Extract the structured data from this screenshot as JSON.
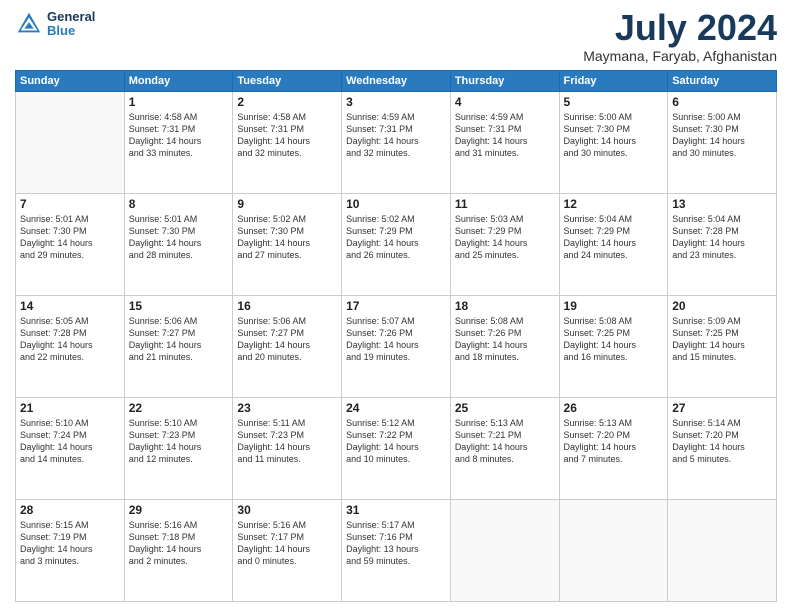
{
  "header": {
    "logo_line1": "General",
    "logo_line2": "Blue",
    "month": "July 2024",
    "location": "Maymana, Faryab, Afghanistan"
  },
  "weekdays": [
    "Sunday",
    "Monday",
    "Tuesday",
    "Wednesday",
    "Thursday",
    "Friday",
    "Saturday"
  ],
  "weeks": [
    [
      {
        "day": "",
        "info": ""
      },
      {
        "day": "1",
        "info": "Sunrise: 4:58 AM\nSunset: 7:31 PM\nDaylight: 14 hours\nand 33 minutes."
      },
      {
        "day": "2",
        "info": "Sunrise: 4:58 AM\nSunset: 7:31 PM\nDaylight: 14 hours\nand 32 minutes."
      },
      {
        "day": "3",
        "info": "Sunrise: 4:59 AM\nSunset: 7:31 PM\nDaylight: 14 hours\nand 32 minutes."
      },
      {
        "day": "4",
        "info": "Sunrise: 4:59 AM\nSunset: 7:31 PM\nDaylight: 14 hours\nand 31 minutes."
      },
      {
        "day": "5",
        "info": "Sunrise: 5:00 AM\nSunset: 7:30 PM\nDaylight: 14 hours\nand 30 minutes."
      },
      {
        "day": "6",
        "info": "Sunrise: 5:00 AM\nSunset: 7:30 PM\nDaylight: 14 hours\nand 30 minutes."
      }
    ],
    [
      {
        "day": "7",
        "info": "Sunrise: 5:01 AM\nSunset: 7:30 PM\nDaylight: 14 hours\nand 29 minutes."
      },
      {
        "day": "8",
        "info": "Sunrise: 5:01 AM\nSunset: 7:30 PM\nDaylight: 14 hours\nand 28 minutes."
      },
      {
        "day": "9",
        "info": "Sunrise: 5:02 AM\nSunset: 7:30 PM\nDaylight: 14 hours\nand 27 minutes."
      },
      {
        "day": "10",
        "info": "Sunrise: 5:02 AM\nSunset: 7:29 PM\nDaylight: 14 hours\nand 26 minutes."
      },
      {
        "day": "11",
        "info": "Sunrise: 5:03 AM\nSunset: 7:29 PM\nDaylight: 14 hours\nand 25 minutes."
      },
      {
        "day": "12",
        "info": "Sunrise: 5:04 AM\nSunset: 7:29 PM\nDaylight: 14 hours\nand 24 minutes."
      },
      {
        "day": "13",
        "info": "Sunrise: 5:04 AM\nSunset: 7:28 PM\nDaylight: 14 hours\nand 23 minutes."
      }
    ],
    [
      {
        "day": "14",
        "info": "Sunrise: 5:05 AM\nSunset: 7:28 PM\nDaylight: 14 hours\nand 22 minutes."
      },
      {
        "day": "15",
        "info": "Sunrise: 5:06 AM\nSunset: 7:27 PM\nDaylight: 14 hours\nand 21 minutes."
      },
      {
        "day": "16",
        "info": "Sunrise: 5:06 AM\nSunset: 7:27 PM\nDaylight: 14 hours\nand 20 minutes."
      },
      {
        "day": "17",
        "info": "Sunrise: 5:07 AM\nSunset: 7:26 PM\nDaylight: 14 hours\nand 19 minutes."
      },
      {
        "day": "18",
        "info": "Sunrise: 5:08 AM\nSunset: 7:26 PM\nDaylight: 14 hours\nand 18 minutes."
      },
      {
        "day": "19",
        "info": "Sunrise: 5:08 AM\nSunset: 7:25 PM\nDaylight: 14 hours\nand 16 minutes."
      },
      {
        "day": "20",
        "info": "Sunrise: 5:09 AM\nSunset: 7:25 PM\nDaylight: 14 hours\nand 15 minutes."
      }
    ],
    [
      {
        "day": "21",
        "info": "Sunrise: 5:10 AM\nSunset: 7:24 PM\nDaylight: 14 hours\nand 14 minutes."
      },
      {
        "day": "22",
        "info": "Sunrise: 5:10 AM\nSunset: 7:23 PM\nDaylight: 14 hours\nand 12 minutes."
      },
      {
        "day": "23",
        "info": "Sunrise: 5:11 AM\nSunset: 7:23 PM\nDaylight: 14 hours\nand 11 minutes."
      },
      {
        "day": "24",
        "info": "Sunrise: 5:12 AM\nSunset: 7:22 PM\nDaylight: 14 hours\nand 10 minutes."
      },
      {
        "day": "25",
        "info": "Sunrise: 5:13 AM\nSunset: 7:21 PM\nDaylight: 14 hours\nand 8 minutes."
      },
      {
        "day": "26",
        "info": "Sunrise: 5:13 AM\nSunset: 7:20 PM\nDaylight: 14 hours\nand 7 minutes."
      },
      {
        "day": "27",
        "info": "Sunrise: 5:14 AM\nSunset: 7:20 PM\nDaylight: 14 hours\nand 5 minutes."
      }
    ],
    [
      {
        "day": "28",
        "info": "Sunrise: 5:15 AM\nSunset: 7:19 PM\nDaylight: 14 hours\nand 3 minutes."
      },
      {
        "day": "29",
        "info": "Sunrise: 5:16 AM\nSunset: 7:18 PM\nDaylight: 14 hours\nand 2 minutes."
      },
      {
        "day": "30",
        "info": "Sunrise: 5:16 AM\nSunset: 7:17 PM\nDaylight: 14 hours\nand 0 minutes."
      },
      {
        "day": "31",
        "info": "Sunrise: 5:17 AM\nSunset: 7:16 PM\nDaylight: 13 hours\nand 59 minutes."
      },
      {
        "day": "",
        "info": ""
      },
      {
        "day": "",
        "info": ""
      },
      {
        "day": "",
        "info": ""
      }
    ]
  ]
}
